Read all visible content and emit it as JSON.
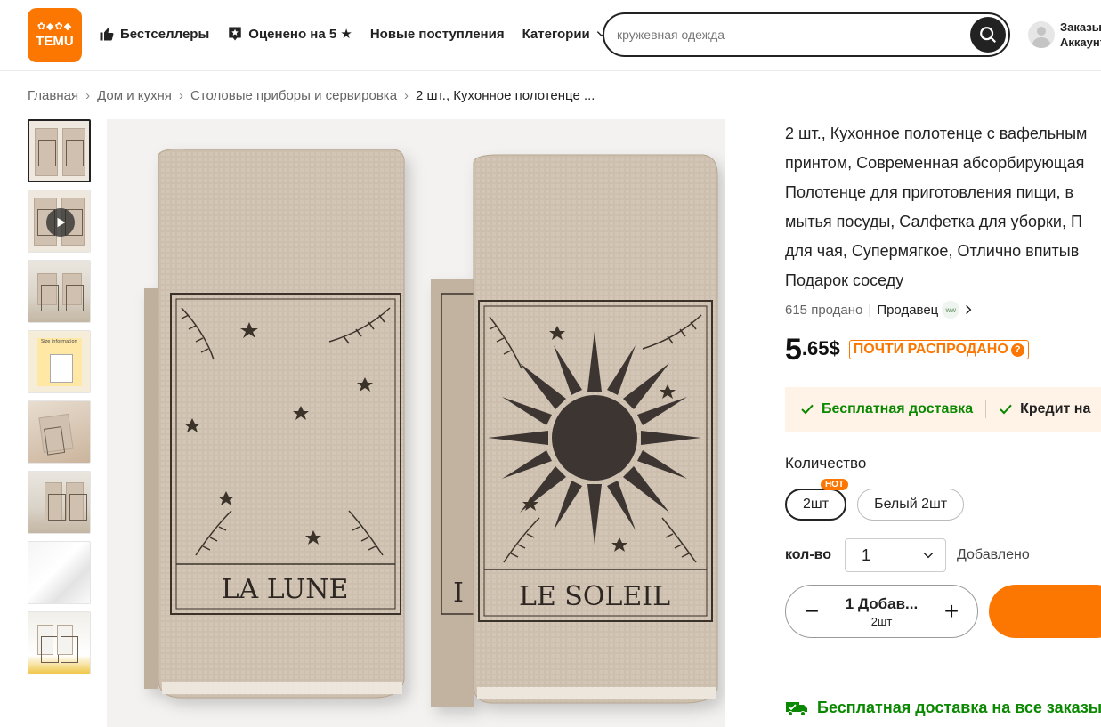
{
  "header": {
    "logo_word": "TEMU",
    "logo_glyphs": "✿◆✿◆",
    "nav": [
      {
        "label": "Бестселлеры",
        "icon": "thumbs-up-icon"
      },
      {
        "label": "Оценено на 5 ★",
        "icon": "rated-badge-icon"
      },
      {
        "label": "Новые поступления"
      },
      {
        "label": "Категории",
        "icon": "chevron-down-icon"
      }
    ],
    "search": {
      "placeholder": "кружевная одежда",
      "value": ""
    },
    "account": {
      "line1": "Заказы",
      "line2": "Аккаунт"
    }
  },
  "breadcrumb": [
    "Главная",
    "Дом и кухня",
    "Столовые приборы и сервировка",
    "2 шт., Кухонное полотенце ..."
  ],
  "thumbnails": [
    {
      "kind": "towels",
      "active": true
    },
    {
      "kind": "video"
    },
    {
      "kind": "room"
    },
    {
      "kind": "size-info",
      "label": "Size information"
    },
    {
      "kind": "stack"
    },
    {
      "kind": "kitchen"
    },
    {
      "kind": "white-fabric"
    },
    {
      "kind": "sunflower"
    }
  ],
  "main_image": {
    "towel_left_text": "LA LUNE",
    "towel_right_text": "LE SOLEIL",
    "left_partial_letter": "I"
  },
  "product": {
    "title_lines": [
      "2 шт., Кухонное полотенце с вафельным",
      "принтом, Современная абсорбирующая",
      "Полотенце для приготовления пищи, в",
      "мытья посуды, Салфетка для уборки, П",
      "для чая, Супермягкое, Отлично впитыв",
      "Подарок соседу"
    ],
    "sold": "615 продано",
    "seller_label": "Продавец",
    "seller_logo_text": "ww",
    "price_int": "5",
    "price_dec": ".65$",
    "badge": "ПОЧТИ РАСПРОДАНО",
    "badge_icon": "?",
    "shipping": [
      "Бесплатная доставка",
      "Кредит на"
    ],
    "quantity_title": "Количество",
    "options": [
      {
        "label": "2шт",
        "selected": true,
        "tag": "HOT"
      },
      {
        "label": "Белый 2шт",
        "selected": false
      }
    ],
    "count_label": "кол-во",
    "count_value": "1",
    "added_text": "Добавлено",
    "stepper": {
      "minus": "−",
      "plus": "+",
      "main": "1 Добав...",
      "sub": "2шт"
    },
    "free_shipping_all": "Бесплатная доставка на все заказы"
  },
  "colors": {
    "brand": "#fb7701",
    "success": "#0a8800",
    "towel": "#cdbfae"
  }
}
